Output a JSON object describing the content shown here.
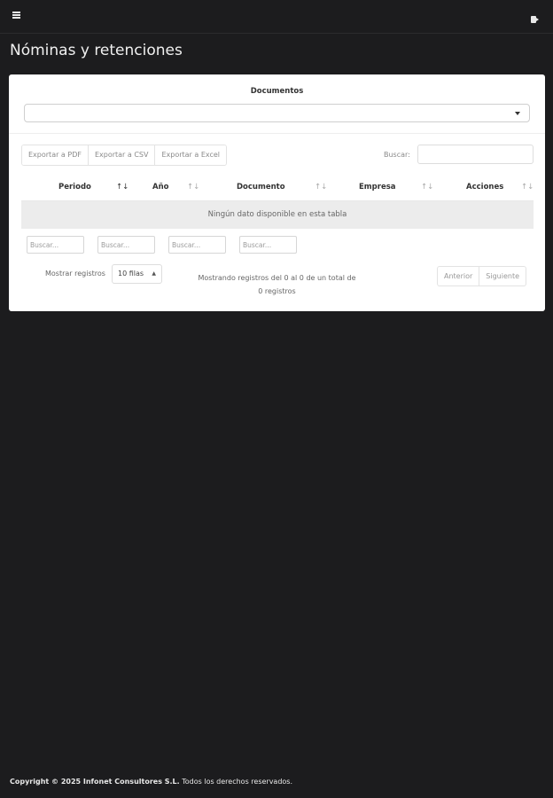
{
  "page": {
    "title": "Nóminas y retenciones"
  },
  "topbar": {
    "menu_icon": "hamburger-menu-icon",
    "logout_icon": "logout-icon"
  },
  "documents": {
    "label": "Documentos",
    "selected": ""
  },
  "export": {
    "pdf": "Exportar a PDF",
    "csv": "Exportar a CSV",
    "excel": "Exportar a Excel"
  },
  "search": {
    "label": "Buscar:",
    "value": ""
  },
  "table": {
    "columns": [
      "Periodo",
      "Año",
      "Documento",
      "Empresa",
      "Acciones"
    ],
    "sort_icons": [
      "↑↓",
      "↑↓",
      "↑↓",
      "↑↓",
      "↑↓"
    ],
    "empty_message": "Ningún dato disponible en esta tabla",
    "filter_placeholder": "Buscar..."
  },
  "length": {
    "label": "Mostrar registros",
    "selected": "10 filas"
  },
  "info": {
    "line1": "Mostrando registros del 0 al 0 de un total de",
    "line2": "0 registros"
  },
  "pagination": {
    "previous": "Anterior",
    "next": "Siguiente"
  },
  "footer": {
    "copyright": "Copyright © 2025 Infonet Consultores S.L.",
    "rights": "Todos los derechos reservados."
  }
}
